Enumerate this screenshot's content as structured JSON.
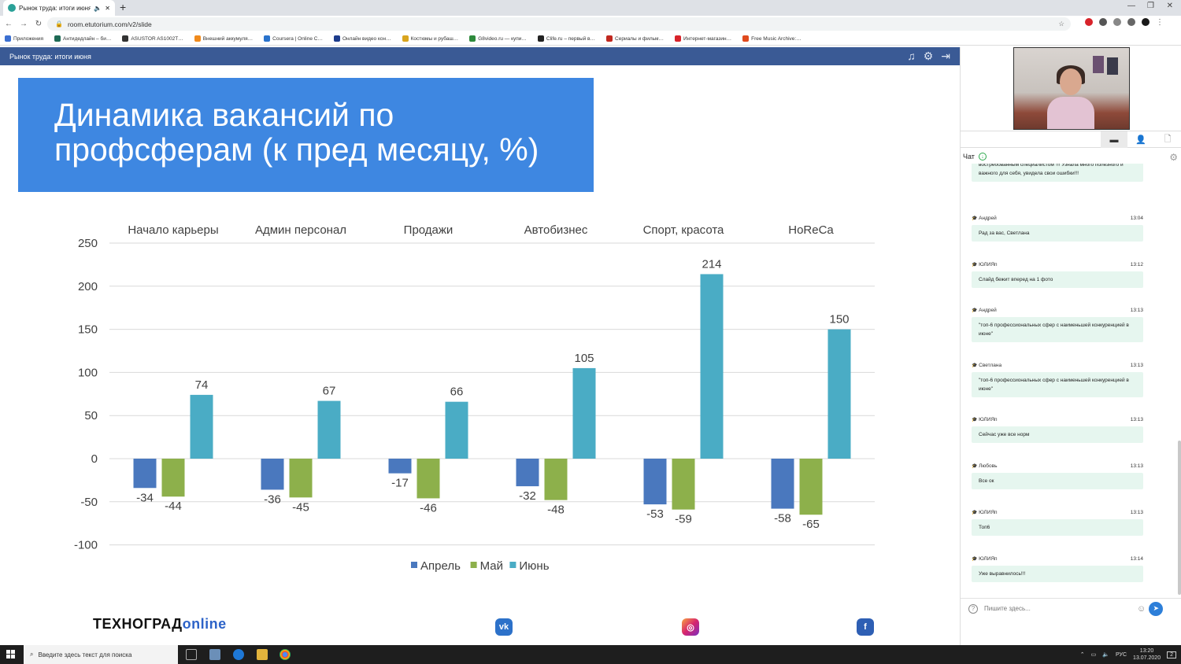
{
  "browser": {
    "tab_title": "Рынок труда: итоги июня",
    "url": "room.etutorium.com/v2/slide",
    "bookmarks": [
      {
        "label": "Приложения",
        "color": "#3b6fd1"
      },
      {
        "label": "Антидедлайн – би…",
        "color": "#1e6a55"
      },
      {
        "label": "ASUSTOR AS1002T…",
        "color": "#333333"
      },
      {
        "label": "Внешний аккумуля…",
        "color": "#f08a1c"
      },
      {
        "label": "Coursera | Online C…",
        "color": "#2a73cc"
      },
      {
        "label": "Онлайн видео кон…",
        "color": "#1d3c8c"
      },
      {
        "label": "Костюмы и рубаш…",
        "color": "#d9a51e"
      },
      {
        "label": "G8video.ru — купи…",
        "color": "#2e8a3c"
      },
      {
        "label": "Clife.ru – первый в…",
        "color": "#222222"
      },
      {
        "label": "Сериалы и фильм…",
        "color": "#c0281f"
      },
      {
        "label": "Интернет-магазин…",
        "color": "#d8232a"
      },
      {
        "label": "Free Music Archive:…",
        "color": "#e04a1e"
      }
    ]
  },
  "appbar": {
    "title": "Рынок труда: итоги июня"
  },
  "slide": {
    "title_line1": "Динамика вакансий по",
    "title_line2": "профсферам (к пред месяцу, %)",
    "brand_part1": "ТЕХНОГРАД",
    "brand_part2": "online",
    "social": [
      "vk",
      "instagram",
      "facebook"
    ]
  },
  "chart_data": {
    "type": "bar",
    "categories": [
      "Начало карьеры",
      "Админ персонал",
      "Продажи",
      "Автобизнес",
      "Спорт, красота",
      "HoReCa"
    ],
    "series": [
      {
        "name": "Апрель",
        "color": "#4a78be",
        "values": [
          -34,
          -36,
          -17,
          -32,
          -53,
          -58
        ]
      },
      {
        "name": "Май",
        "color": "#8db04b",
        "values": [
          -44,
          -45,
          -46,
          -48,
          -59,
          -65
        ]
      },
      {
        "name": "Июнь",
        "color": "#4aacc5",
        "values": [
          74,
          67,
          66,
          105,
          214,
          150
        ]
      }
    ],
    "ylim": [
      -100,
      250
    ],
    "yticks": [
      250,
      200,
      150,
      100,
      50,
      0,
      -50,
      -100
    ],
    "grid": true,
    "legend": "bottom",
    "category_labels_position": "top"
  },
  "chat": {
    "header": "Чат",
    "input_placeholder": "Пишите здесь...",
    "messages": [
      {
        "author": "",
        "time": "",
        "text": "востребованным специалистом\"!!! Узнала много полезного и важного для себя, увидела свои ошибки!!!"
      },
      {
        "author": "Андрей",
        "time": "13:04",
        "text": "Рад за вас, Светлана"
      },
      {
        "author": "ЮЛИЯп",
        "time": "13:12",
        "text": "Слайд бежит вперед на 1 фото"
      },
      {
        "author": "Андрей",
        "time": "13:13",
        "text": "\"топ-6 профессиональных сфер с наименьшей конкуренцией в июне\""
      },
      {
        "author": "Светлана",
        "time": "13:13",
        "text": "\"топ-6 профессиональных сфер с наименьшей конкуренцией в июне\""
      },
      {
        "author": "ЮЛИЯп",
        "time": "13:13",
        "text": "Сейчас уже все норм"
      },
      {
        "author": "Любовь",
        "time": "13:13",
        "text": "Все ок"
      },
      {
        "author": "ЮЛИЯп",
        "time": "13:13",
        "text": "Топ6"
      },
      {
        "author": "ЮЛИЯп",
        "time": "13:14",
        "text": "Уже выравнилось!!!"
      }
    ]
  },
  "taskbar": {
    "search_placeholder": "Введите здесь текст для поиска",
    "lang": "РУС",
    "time": "13:20",
    "date": "13.07.2020",
    "notifications": "2"
  }
}
